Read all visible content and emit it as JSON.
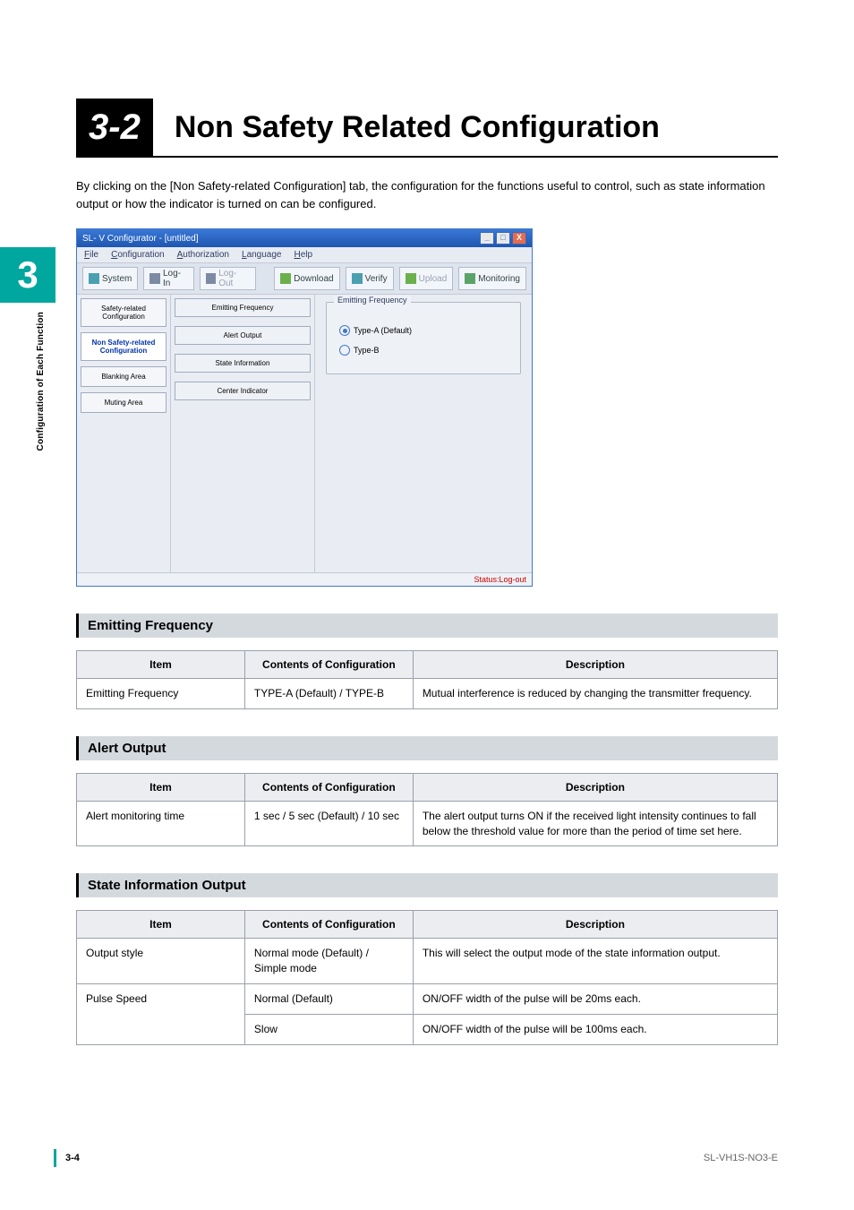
{
  "chapter": {
    "number": "3",
    "side_label": "Configuration of Each Function"
  },
  "header": {
    "section_number": "3-2",
    "section_title": "Non Safety Related Configuration"
  },
  "intro": "By clicking on the [Non Safety-related Configuration] tab, the configuration for the functions useful to control, such as state information output or how the indicator is turned on can be configured.",
  "app": {
    "title": "SL- V Configurator - [untitled]",
    "menubar": [
      "File",
      "Configuration",
      "Authorization",
      "Language",
      "Help"
    ],
    "toolbar": {
      "system": "System",
      "login": "Log-In",
      "logout": "Log-Out",
      "download": "Download",
      "verify": "Verify",
      "upload": "Upload",
      "monitoring": "Monitoring"
    },
    "side_nav": {
      "safety": "Safety-related\nConfiguration",
      "non_safety": "Non Safety-related\nConfiguration",
      "blanking": "Blanking Area",
      "muting": "Muting Area"
    },
    "config_buttons": {
      "emitting": "Emitting Frequency",
      "alert": "Alert Output",
      "state": "State Information",
      "center": "Center Indicator"
    },
    "panel": {
      "group": "Emitting Frequency",
      "opt_a": "Type-A (Default)",
      "opt_b": "Type-B"
    },
    "status_text": "Status:Log-out"
  },
  "table_headers": {
    "item": "Item",
    "contents": "Contents of Configuration",
    "description": "Description"
  },
  "sections": {
    "emitting": {
      "title": "Emitting Frequency",
      "rows": [
        {
          "item": "Emitting Frequency",
          "conf": "TYPE-A (Default) / TYPE-B",
          "desc": "Mutual interference is reduced by changing the transmitter frequency."
        }
      ]
    },
    "alert": {
      "title": "Alert Output",
      "rows": [
        {
          "item": "Alert monitoring time",
          "conf": "1 sec / 5 sec (Default) / 10 sec",
          "desc": "The alert output turns ON if the received light intensity continues to fall below the threshold value for more than the period of time set here."
        }
      ]
    },
    "state": {
      "title": "State Information Output",
      "rows": [
        {
          "item": "Output style",
          "conf": "Normal mode (Default) / Simple mode",
          "desc": "This will select the output mode of the state information output."
        },
        {
          "item": "Pulse Speed",
          "conf": "Normal (Default)",
          "desc": "ON/OFF width of the pulse will be 20ms each."
        },
        {
          "item": "",
          "conf": "Slow",
          "desc": "ON/OFF width of the pulse will be 100ms each."
        }
      ]
    }
  },
  "footer": {
    "page": "3-4",
    "doc": "SL-VH1S-NO3-E"
  }
}
